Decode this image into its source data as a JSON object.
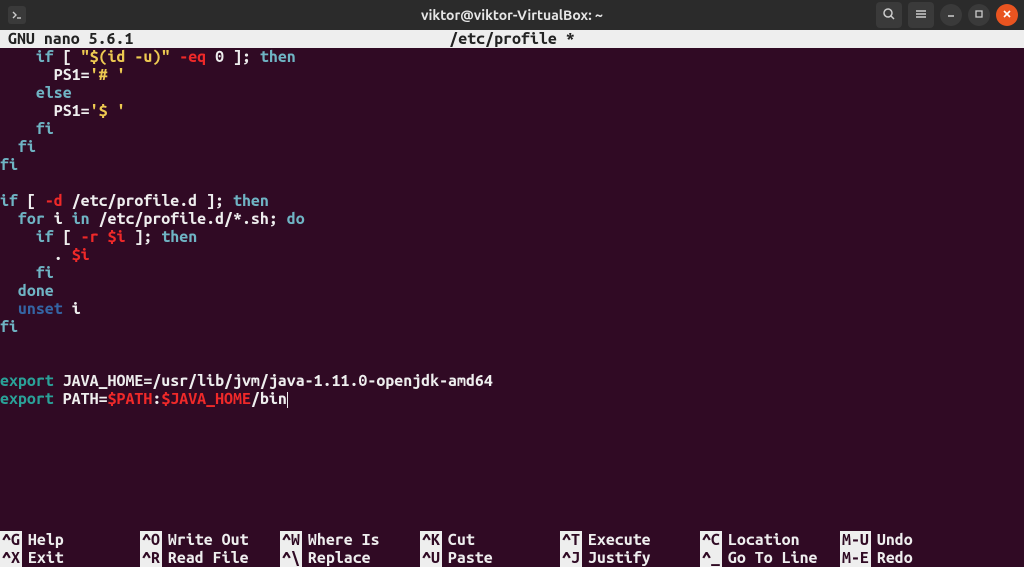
{
  "titlebar": {
    "title": "viktor@viktor-VirtualBox: ~"
  },
  "nano": {
    "version": "GNU  nano 5.6.1",
    "filename": "/etc/profile *"
  },
  "lines": [
    {
      "indent": "    ",
      "tokens": [
        {
          "t": "if",
          "c": "c-kw"
        },
        {
          "t": " [ "
        },
        {
          "t": "\"$(id -u)\"",
          "c": "c-str"
        },
        {
          "t": " "
        },
        {
          "t": "-eq",
          "c": "c-red"
        },
        {
          "t": " "
        },
        {
          "t": "0",
          "c": ""
        },
        {
          "t": " ]; "
        },
        {
          "t": "then",
          "c": "c-kw"
        }
      ]
    },
    {
      "indent": "      ",
      "tokens": [
        {
          "t": "PS1"
        },
        {
          "t": "="
        },
        {
          "t": "'# '",
          "c": "c-str"
        }
      ]
    },
    {
      "indent": "    ",
      "tokens": [
        {
          "t": "else",
          "c": "c-kw"
        }
      ]
    },
    {
      "indent": "      ",
      "tokens": [
        {
          "t": "PS1"
        },
        {
          "t": "="
        },
        {
          "t": "'$ '",
          "c": "c-str"
        }
      ]
    },
    {
      "indent": "    ",
      "tokens": [
        {
          "t": "fi",
          "c": "c-kw"
        }
      ]
    },
    {
      "indent": "  ",
      "tokens": [
        {
          "t": "fi",
          "c": "c-kw"
        }
      ]
    },
    {
      "indent": "",
      "tokens": [
        {
          "t": "fi",
          "c": "c-kw"
        }
      ]
    },
    {
      "indent": "",
      "tokens": []
    },
    {
      "indent": "",
      "tokens": [
        {
          "t": "if",
          "c": "c-kw"
        },
        {
          "t": " [ "
        },
        {
          "t": "-d",
          "c": "c-red"
        },
        {
          "t": " /etc/profile.d ]; "
        },
        {
          "t": "then",
          "c": "c-kw"
        }
      ]
    },
    {
      "indent": "  ",
      "tokens": [
        {
          "t": "for",
          "c": "c-kw"
        },
        {
          "t": " i "
        },
        {
          "t": "in",
          "c": "c-kw"
        },
        {
          "t": " /etc/profile.d/*.sh; "
        },
        {
          "t": "do",
          "c": "c-kw"
        }
      ]
    },
    {
      "indent": "    ",
      "tokens": [
        {
          "t": "if",
          "c": "c-kw"
        },
        {
          "t": " [ "
        },
        {
          "t": "-r",
          "c": "c-red"
        },
        {
          "t": " "
        },
        {
          "t": "$i",
          "c": "c-red"
        },
        {
          "t": " ]; "
        },
        {
          "t": "then",
          "c": "c-kw"
        }
      ]
    },
    {
      "indent": "      ",
      "tokens": [
        {
          "t": ". "
        },
        {
          "t": "$i",
          "c": "c-red"
        }
      ]
    },
    {
      "indent": "    ",
      "tokens": [
        {
          "t": "fi",
          "c": "c-kw"
        }
      ]
    },
    {
      "indent": "  ",
      "tokens": [
        {
          "t": "done",
          "c": "c-kw"
        }
      ]
    },
    {
      "indent": "  ",
      "tokens": [
        {
          "t": "unset",
          "c": "c-unset"
        },
        {
          "t": " i"
        }
      ]
    },
    {
      "indent": "",
      "tokens": [
        {
          "t": "fi",
          "c": "c-kw"
        }
      ]
    },
    {
      "indent": "",
      "tokens": []
    },
    {
      "indent": "",
      "tokens": []
    },
    {
      "indent": "",
      "tokens": [
        {
          "t": "export",
          "c": "c-export"
        },
        {
          "t": " JAVA_HOME"
        },
        {
          "t": "=",
          "c": ""
        },
        {
          "t": "/usr/lib/jvm/java-1.11.0-openjdk-amd64"
        }
      ]
    },
    {
      "indent": "",
      "tokens": [
        {
          "t": "export",
          "c": "c-export"
        },
        {
          "t": " PATH"
        },
        {
          "t": "="
        },
        {
          "t": "$PATH",
          "c": "c-red"
        },
        {
          "t": ":",
          "c": ""
        },
        {
          "t": "$JAVA_HOME",
          "c": "c-red"
        },
        {
          "t": "/bin"
        },
        {
          "t": "",
          "cursor": true
        }
      ]
    }
  ],
  "help": {
    "row1": [
      {
        "key": "^G",
        "label": "Help"
      },
      {
        "key": "^O",
        "label": "Write Out"
      },
      {
        "key": "^W",
        "label": "Where Is"
      },
      {
        "key": "^K",
        "label": "Cut"
      },
      {
        "key": "^T",
        "label": "Execute"
      },
      {
        "key": "^C",
        "label": "Location"
      },
      {
        "key": "M-U",
        "label": "Undo"
      }
    ],
    "row2": [
      {
        "key": "^X",
        "label": "Exit"
      },
      {
        "key": "^R",
        "label": "Read File"
      },
      {
        "key": "^\\",
        "label": "Replace"
      },
      {
        "key": "^U",
        "label": "Paste"
      },
      {
        "key": "^J",
        "label": "Justify"
      },
      {
        "key": "^_",
        "label": "Go To Line"
      },
      {
        "key": "M-E",
        "label": "Redo"
      }
    ]
  }
}
